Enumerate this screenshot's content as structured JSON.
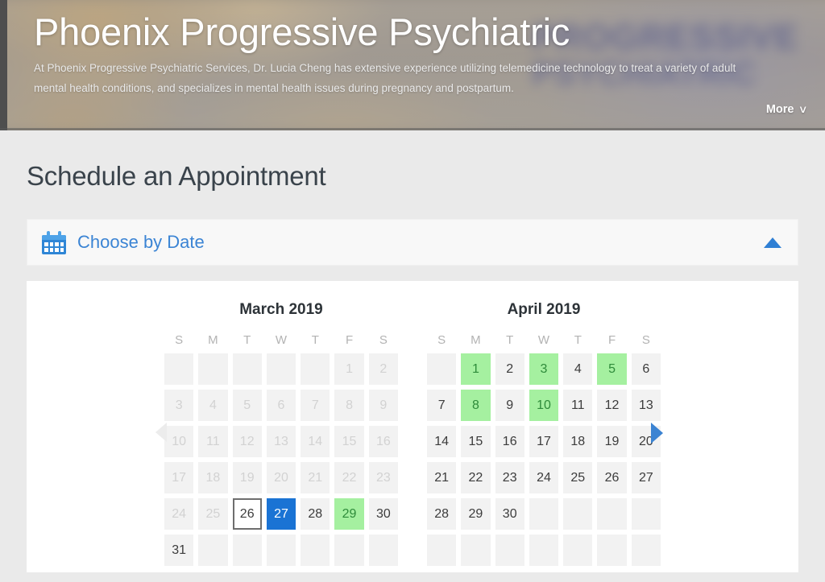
{
  "hero": {
    "title": "Phoenix Progressive Psychiatric",
    "description": "At Phoenix Progressive Psychiatric Services, Dr. Lucia Cheng has extensive experience utilizing telemedicine technology to treat a variety of adult mental health conditions, and specializes in mental health issues during pregnancy and postpartum.",
    "more_label": "More",
    "more_chevron": "∨",
    "logo_line1": "PROGRESSIVE",
    "logo_line2": "PSYCHIATRIC"
  },
  "page": {
    "title": "Schedule an Appointment"
  },
  "accordion": {
    "label": "Choose by Date",
    "icon": "calendar-icon",
    "toggle_state": "expanded",
    "toggle_icon": "triangle-up-icon",
    "accent_color": "#3b84d4"
  },
  "calendar": {
    "prev_label": "◀",
    "next_label": "▶",
    "prev_enabled": false,
    "next_enabled": true,
    "day_headers": [
      "S",
      "M",
      "T",
      "W",
      "T",
      "F",
      "S"
    ],
    "colors": {
      "available_bg": "#a5f0a0",
      "available_text": "#2e8b3a",
      "selected_bg": "#1a73d4",
      "selected_text": "#ffffff",
      "today_border": "#6e6e6e",
      "default_bg": "#f2f2f2",
      "disabled_text": "#d2d2d2"
    },
    "months": [
      {
        "title": "March 2019",
        "weeks": [
          [
            {
              "label": "",
              "state": "empty"
            },
            {
              "label": "",
              "state": "empty"
            },
            {
              "label": "",
              "state": "empty"
            },
            {
              "label": "",
              "state": "empty"
            },
            {
              "label": "",
              "state": "empty"
            },
            {
              "label": "1",
              "state": "disabled"
            },
            {
              "label": "2",
              "state": "disabled"
            }
          ],
          [
            {
              "label": "3",
              "state": "disabled"
            },
            {
              "label": "4",
              "state": "disabled"
            },
            {
              "label": "5",
              "state": "disabled"
            },
            {
              "label": "6",
              "state": "disabled"
            },
            {
              "label": "7",
              "state": "disabled"
            },
            {
              "label": "8",
              "state": "disabled"
            },
            {
              "label": "9",
              "state": "disabled"
            }
          ],
          [
            {
              "label": "10",
              "state": "disabled"
            },
            {
              "label": "11",
              "state": "disabled"
            },
            {
              "label": "12",
              "state": "disabled"
            },
            {
              "label": "13",
              "state": "disabled"
            },
            {
              "label": "14",
              "state": "disabled"
            },
            {
              "label": "15",
              "state": "disabled"
            },
            {
              "label": "16",
              "state": "disabled"
            }
          ],
          [
            {
              "label": "17",
              "state": "disabled"
            },
            {
              "label": "18",
              "state": "disabled"
            },
            {
              "label": "19",
              "state": "disabled"
            },
            {
              "label": "20",
              "state": "disabled"
            },
            {
              "label": "21",
              "state": "disabled"
            },
            {
              "label": "22",
              "state": "disabled"
            },
            {
              "label": "23",
              "state": "disabled"
            }
          ],
          [
            {
              "label": "24",
              "state": "disabled"
            },
            {
              "label": "25",
              "state": "disabled"
            },
            {
              "label": "26",
              "state": "today"
            },
            {
              "label": "27",
              "state": "selected"
            },
            {
              "label": "28",
              "state": "normal"
            },
            {
              "label": "29",
              "state": "available"
            },
            {
              "label": "30",
              "state": "normal"
            }
          ],
          [
            {
              "label": "31",
              "state": "normal"
            },
            {
              "label": "",
              "state": "empty"
            },
            {
              "label": "",
              "state": "empty"
            },
            {
              "label": "",
              "state": "empty"
            },
            {
              "label": "",
              "state": "empty"
            },
            {
              "label": "",
              "state": "empty"
            },
            {
              "label": "",
              "state": "empty"
            }
          ]
        ]
      },
      {
        "title": "April 2019",
        "weeks": [
          [
            {
              "label": "",
              "state": "empty"
            },
            {
              "label": "1",
              "state": "available"
            },
            {
              "label": "2",
              "state": "normal"
            },
            {
              "label": "3",
              "state": "available"
            },
            {
              "label": "4",
              "state": "normal"
            },
            {
              "label": "5",
              "state": "available"
            },
            {
              "label": "6",
              "state": "normal"
            }
          ],
          [
            {
              "label": "7",
              "state": "normal"
            },
            {
              "label": "8",
              "state": "available"
            },
            {
              "label": "9",
              "state": "normal"
            },
            {
              "label": "10",
              "state": "available"
            },
            {
              "label": "11",
              "state": "normal"
            },
            {
              "label": "12",
              "state": "normal"
            },
            {
              "label": "13",
              "state": "normal"
            }
          ],
          [
            {
              "label": "14",
              "state": "normal"
            },
            {
              "label": "15",
              "state": "normal"
            },
            {
              "label": "16",
              "state": "normal"
            },
            {
              "label": "17",
              "state": "normal"
            },
            {
              "label": "18",
              "state": "normal"
            },
            {
              "label": "19",
              "state": "normal"
            },
            {
              "label": "20",
              "state": "normal"
            }
          ],
          [
            {
              "label": "21",
              "state": "normal"
            },
            {
              "label": "22",
              "state": "normal"
            },
            {
              "label": "23",
              "state": "normal"
            },
            {
              "label": "24",
              "state": "normal"
            },
            {
              "label": "25",
              "state": "normal"
            },
            {
              "label": "26",
              "state": "normal"
            },
            {
              "label": "27",
              "state": "normal"
            }
          ],
          [
            {
              "label": "28",
              "state": "normal"
            },
            {
              "label": "29",
              "state": "normal"
            },
            {
              "label": "30",
              "state": "normal"
            },
            {
              "label": "",
              "state": "empty"
            },
            {
              "label": "",
              "state": "empty"
            },
            {
              "label": "",
              "state": "empty"
            },
            {
              "label": "",
              "state": "empty"
            }
          ],
          [
            {
              "label": "",
              "state": "empty"
            },
            {
              "label": "",
              "state": "empty"
            },
            {
              "label": "",
              "state": "empty"
            },
            {
              "label": "",
              "state": "empty"
            },
            {
              "label": "",
              "state": "empty"
            },
            {
              "label": "",
              "state": "empty"
            },
            {
              "label": "",
              "state": "empty"
            }
          ]
        ]
      }
    ]
  }
}
